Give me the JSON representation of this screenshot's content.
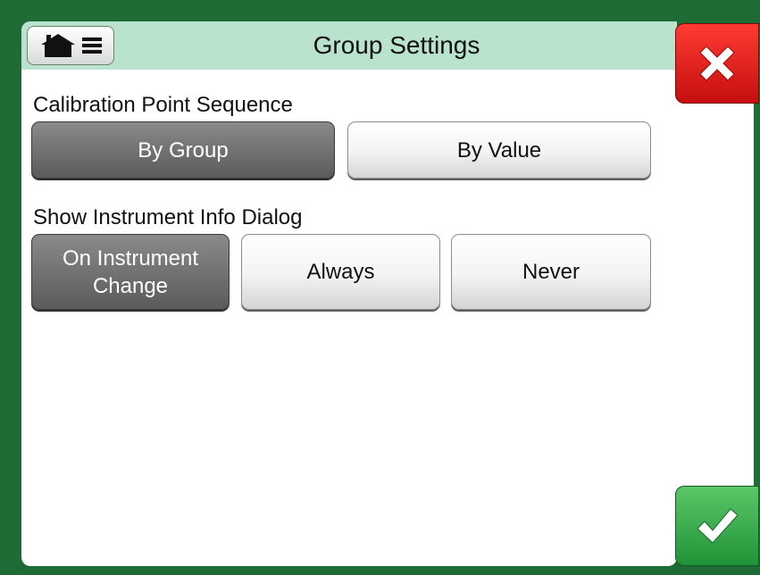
{
  "header": {
    "title": "Group Settings"
  },
  "calibration": {
    "label": "Calibration Point Sequence",
    "options": [
      "By Group",
      "By Value"
    ],
    "selected": "By Group"
  },
  "instrument_info": {
    "label": "Show Instrument Info Dialog",
    "options": [
      "On Instrument\nChange",
      "Always",
      "Never"
    ],
    "selected": "On Instrument\nChange"
  },
  "icons": {
    "home": "home-icon",
    "menu": "menu-icon",
    "close": "close-icon",
    "ok": "checkmark-icon"
  },
  "colors": {
    "background_frame": "#1e6b35",
    "header": "#b9e3cc",
    "selected_button": "#6e6e6e",
    "close": "#e8221b",
    "ok": "#3aac4e"
  }
}
